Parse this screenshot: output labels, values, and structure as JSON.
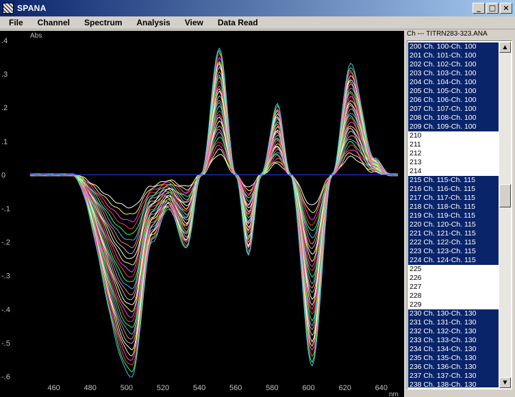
{
  "window": {
    "title": "SPANA"
  },
  "menu": [
    "File",
    "Channel",
    "Spectrum",
    "Analysis",
    "View",
    "Data Read"
  ],
  "list_header": "Ch --- TITRN283-323.ANA",
  "channel_list": [
    {
      "text": "200 Ch. 100-Ch. 100",
      "selected": true
    },
    {
      "text": "201 Ch. 101-Ch. 100",
      "selected": true
    },
    {
      "text": "202 Ch. 102-Ch. 100",
      "selected": true
    },
    {
      "text": "203 Ch. 103-Ch. 100",
      "selected": true
    },
    {
      "text": "204 Ch. 104-Ch. 100",
      "selected": true
    },
    {
      "text": "205 Ch. 105-Ch. 100",
      "selected": true
    },
    {
      "text": "206 Ch. 106-Ch. 100",
      "selected": true
    },
    {
      "text": "207 Ch. 107-Ch. 100",
      "selected": true
    },
    {
      "text": "208 Ch. 108-Ch. 100",
      "selected": true
    },
    {
      "text": "209 Ch. 109-Ch. 100",
      "selected": true
    },
    {
      "text": "210",
      "selected": false
    },
    {
      "text": "211",
      "selected": false
    },
    {
      "text": "212",
      "selected": false
    },
    {
      "text": "213",
      "selected": false
    },
    {
      "text": "214",
      "selected": false
    },
    {
      "text": "215 Ch. 115-Ch. 115",
      "selected": true
    },
    {
      "text": "216 Ch. 116-Ch. 115",
      "selected": true
    },
    {
      "text": "217 Ch. 117-Ch. 115",
      "selected": true
    },
    {
      "text": "218 Ch. 118-Ch. 115",
      "selected": true
    },
    {
      "text": "219 Ch. 119-Ch. 115",
      "selected": true
    },
    {
      "text": "220 Ch. 120-Ch. 115",
      "selected": true
    },
    {
      "text": "221 Ch. 121-Ch. 115",
      "selected": true
    },
    {
      "text": "222 Ch. 122-Ch. 115",
      "selected": true
    },
    {
      "text": "223 Ch. 123-Ch. 115",
      "selected": true
    },
    {
      "text": "224 Ch. 124-Ch. 115",
      "selected": true
    },
    {
      "text": "225",
      "selected": false
    },
    {
      "text": "226",
      "selected": false
    },
    {
      "text": "227",
      "selected": false
    },
    {
      "text": "228",
      "selected": false
    },
    {
      "text": "229",
      "selected": false
    },
    {
      "text": "230 Ch. 130-Ch. 130",
      "selected": true
    },
    {
      "text": "231 Ch. 131-Ch. 130",
      "selected": true
    },
    {
      "text": "232 Ch. 132-Ch. 130",
      "selected": true
    },
    {
      "text": "233 Ch. 133-Ch. 130",
      "selected": true
    },
    {
      "text": "234 Ch. 134-Ch. 130",
      "selected": true
    },
    {
      "text": "235 Ch. 135-Ch. 130",
      "selected": true
    },
    {
      "text": "236 Ch. 136-Ch. 130",
      "selected": true
    },
    {
      "text": "237 Ch. 137-Ch. 130",
      "selected": true
    },
    {
      "text": "238 Ch. 138-Ch. 130",
      "selected": true
    }
  ],
  "icons": {
    "app": "spana-app-icon",
    "minimize": "minimize-icon",
    "maximize": "maximize-icon",
    "close": "close-icon",
    "scroll_up": "scroll-up-arrow-icon",
    "scroll_down": "scroll-down-arrow-icon"
  },
  "colors": {
    "plot_background": "#000000",
    "axis_text": "#c0c0c0",
    "baseline": "#2040ff",
    "selection": "#0a246a",
    "series_palette": [
      "#ffffff",
      "#ffff40",
      "#ff40ff",
      "#ff4040",
      "#40ff40",
      "#40c0ff",
      "#ff8080",
      "#c0c0c0"
    ]
  },
  "chart_data": {
    "type": "line",
    "xlabel": "nm",
    "ylabel": "Abs",
    "xlim": [
      447,
      651
    ],
    "ylim": [
      -0.6,
      0.4
    ],
    "xticks": [
      460,
      480,
      500,
      520,
      540,
      560,
      580,
      600,
      620,
      640
    ],
    "yticks": [
      0.4,
      0.3,
      0.2,
      0.1,
      0,
      -0.1,
      -0.2,
      -0.3,
      -0.4,
      -0.5,
      -0.6
    ],
    "ytick_labels": [
      ".4",
      ".3",
      ".2",
      ".1",
      "0",
      "-.1",
      "-.2",
      "-.3",
      "-.4",
      "-.5",
      "-.6"
    ],
    "series_count": 30,
    "baseline_y": 0,
    "feature_points": [
      {
        "x": 447,
        "y": 0.0
      },
      {
        "x": 470,
        "y": 0.0
      },
      {
        "x": 503,
        "y": -0.6
      },
      {
        "x": 514,
        "y": -0.2
      },
      {
        "x": 523,
        "y": -0.1
      },
      {
        "x": 533,
        "y": -0.22
      },
      {
        "x": 541,
        "y": 0.0
      },
      {
        "x": 551,
        "y": 0.38
      },
      {
        "x": 560,
        "y": 0.0
      },
      {
        "x": 567,
        "y": -0.24
      },
      {
        "x": 574,
        "y": 0.0
      },
      {
        "x": 583,
        "y": 0.21
      },
      {
        "x": 590,
        "y": 0.0
      },
      {
        "x": 602,
        "y": -0.57
      },
      {
        "x": 613,
        "y": 0.0
      },
      {
        "x": 623,
        "y": 0.33
      },
      {
        "x": 636,
        "y": 0.05
      },
      {
        "x": 645,
        "y": 0.0
      },
      {
        "x": 650,
        "y": 0.0
      }
    ]
  }
}
